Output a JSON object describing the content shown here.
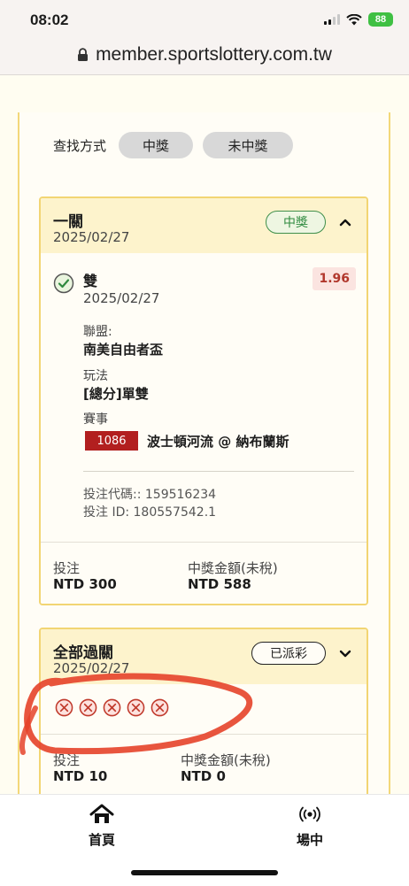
{
  "status_bar": {
    "time": "08:02",
    "battery": "88"
  },
  "browser": {
    "url": "member.sportslottery.com.tw"
  },
  "filter": {
    "label": "查找方式",
    "options": [
      "中獎",
      "未中獎"
    ]
  },
  "cards": [
    {
      "title": "一關",
      "date": "2025/02/27",
      "badge": "中獎",
      "expanded": true,
      "selection": {
        "name": "雙",
        "date": "2025/02/27",
        "odds": "1.96",
        "league_label": "聯盟:",
        "league": "南美自由者盃",
        "market_label": "玩法",
        "market": "[總分]單雙",
        "event_label": "賽事",
        "event_number": "1086",
        "event": "波士頓河流 @ 納布蘭斯",
        "bet_code": "投注代碼:: 159516234",
        "bet_id": "投注 ID: 180557542.1"
      },
      "stake_label": "投注",
      "stake": "NTD 300",
      "payout_label": "中獎金額(未稅)",
      "payout": "NTD 588"
    },
    {
      "title": "全部過關",
      "date": "2025/02/27",
      "badge": "已派彩",
      "expanded": false,
      "lost_legs": 5,
      "stake_label": "投注",
      "stake": "NTD 10",
      "payout_label": "中獎金額(未稅)",
      "payout": "NTD 0"
    }
  ],
  "bottom_nav": {
    "items": [
      {
        "label": "首頁",
        "icon": "home-icon"
      },
      {
        "label": "場中",
        "icon": "live-broadcast-icon"
      }
    ]
  },
  "colors": {
    "win": "#2f8a3f",
    "loss": "#c0392b",
    "header": "#fdf3cc",
    "border": "#f2d573",
    "event": "#b21f1f",
    "annotation": "#e5432a"
  }
}
